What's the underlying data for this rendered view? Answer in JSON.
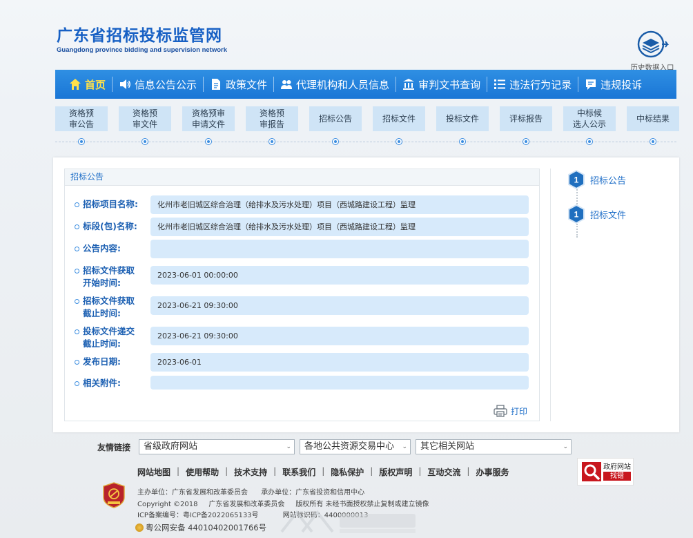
{
  "header": {
    "logo_cn": "广东省招标投标监管网",
    "logo_en": "Guangdong province bidding and supervision network",
    "history_label": "历史数据入口"
  },
  "main_nav": [
    {
      "label": "首页",
      "icon": "home-icon",
      "active": true
    },
    {
      "label": "信息公告公示",
      "icon": "speaker-icon"
    },
    {
      "label": "政策文件",
      "icon": "document-icon"
    },
    {
      "label": "代理机构和人员信息",
      "icon": "people-icon"
    },
    {
      "label": "审判文书查询",
      "icon": "courthouse-icon"
    },
    {
      "label": "违法行为记录",
      "icon": "list-icon"
    },
    {
      "label": "违规投诉",
      "icon": "chat-icon"
    }
  ],
  "steps": [
    {
      "line1": "资格预",
      "line2": "审公告"
    },
    {
      "line1": "资格预",
      "line2": "审文件"
    },
    {
      "line1": "资格预审",
      "line2": "申请文件"
    },
    {
      "line1": "资格预",
      "line2": "审报告"
    },
    {
      "line1": "招标公告",
      "line2": ""
    },
    {
      "line1": "招标文件",
      "line2": ""
    },
    {
      "line1": "投标文件",
      "line2": ""
    },
    {
      "line1": "评标报告",
      "line2": ""
    },
    {
      "line1": "中标候",
      "line2": "选人公示"
    },
    {
      "line1": "中标结果",
      "line2": ""
    }
  ],
  "form": {
    "title": "招标公告",
    "rows": [
      {
        "label1": "招标项目名称:",
        "label2": "",
        "value": "化州市老旧城区综合治理（给排水及污水处理）项目（西城路建设工程）监理"
      },
      {
        "label1": "标段(包)名称:",
        "label2": "",
        "value": "化州市老旧城区综合治理（给排水及污水处理）项目（西城路建设工程）监理"
      },
      {
        "label1": "公告内容:",
        "label2": "",
        "value": ""
      },
      {
        "label1": "招标文件获取",
        "label2": "开始时间:",
        "value": "2023-06-01 00:00:00"
      },
      {
        "label1": "招标文件获取",
        "label2": "截止时间:",
        "value": "2023-06-21 09:30:00"
      },
      {
        "label1": "投标文件递交",
        "label2": "截止时间:",
        "value": "2023-06-21 09:30:00"
      },
      {
        "label1": "发布日期:",
        "label2": "",
        "value": "2023-06-01"
      },
      {
        "label1": "相关附件:",
        "label2": "",
        "value": ""
      }
    ],
    "print_label": "打印"
  },
  "side_steps": [
    {
      "number": "1",
      "label": "招标公告"
    },
    {
      "number": "1",
      "label": "招标文件"
    }
  ],
  "footer": {
    "friend_label": "友情链接",
    "selects": [
      "省级政府网站",
      "各地公共资源交易中心",
      "其它相关网站"
    ],
    "links": [
      "网站地图",
      "使用帮助",
      "技术支持",
      "联系我们",
      "隐私保护",
      "版权声明",
      "互动交流",
      "办事服务"
    ],
    "gov_badge_line1": "政府网站",
    "gov_badge_line2": "找错",
    "sponsor": "主办单位：广东省发展和改革委员会",
    "organizer": "承办单位：广东省投资和信用中心",
    "copyright": "Copyright ©2018",
    "copyright_org": "广东省发展和改革委员会",
    "rights": "版权所有 未经书面授权禁止复制或建立镜像",
    "icp": "ICP备案编号：粤ICP备2022065133号",
    "site_id": "网站标识码：4400000013",
    "police": "粤公网安备 44010402001766号"
  },
  "colors": {
    "nav_blue": "#1f7ed9",
    "active_nav": "#ffe14a",
    "step_bg": "#cfe4f6",
    "field_bg": "#d7eafb",
    "label_blue": "#1b5fb2"
  }
}
